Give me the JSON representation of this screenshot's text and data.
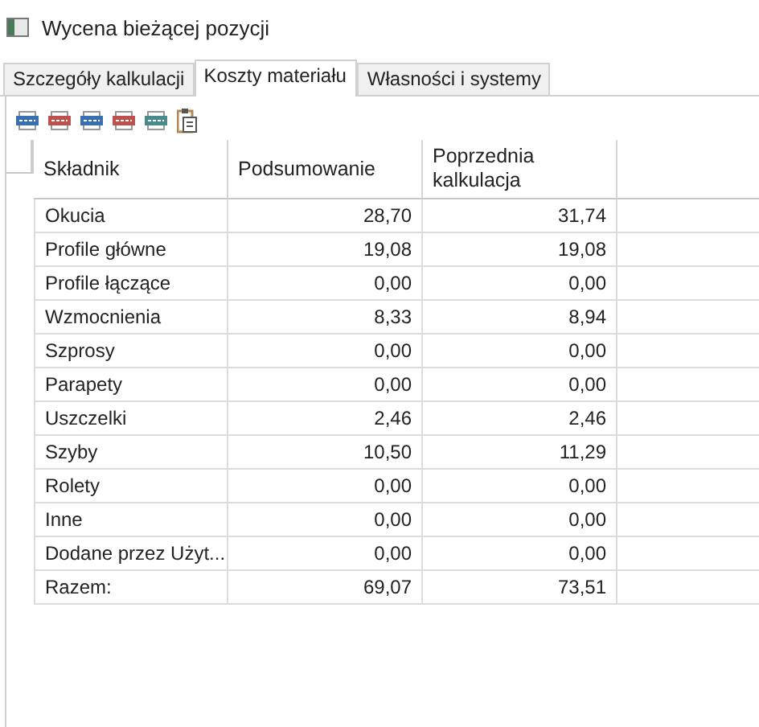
{
  "window": {
    "title": "Wycena bieżącej pozycji"
  },
  "tabs": [
    {
      "label": "Szczegóły kalkulacji",
      "selected": false
    },
    {
      "label": "Koszty materiału",
      "selected": true
    },
    {
      "label": "Własności i systemy",
      "selected": false
    }
  ],
  "toolbar": [
    {
      "kind": "csv",
      "color": "#3a6fb0"
    },
    {
      "kind": "pdf",
      "color": "#c0504d"
    },
    {
      "kind": "doc",
      "color": "#3a6fb0"
    },
    {
      "kind": "img",
      "color": "#c0504d"
    },
    {
      "kind": "xlsx",
      "color": "#4a8a8a"
    },
    {
      "kind": "clipboard",
      "color": "#b08a50"
    }
  ],
  "table": {
    "columns": [
      "Składnik",
      "Podsumowanie",
      "Poprzednia kalkulacja"
    ],
    "rows": [
      [
        "Okucia",
        "28,70",
        "31,74"
      ],
      [
        "Profile główne",
        "19,08",
        "19,08"
      ],
      [
        "Profile łączące",
        "0,00",
        "0,00"
      ],
      [
        "Wzmocnienia",
        "8,33",
        "8,94"
      ],
      [
        "Szprosy",
        "0,00",
        "0,00"
      ],
      [
        "Parapety",
        "0,00",
        "0,00"
      ],
      [
        "Uszczelki",
        "2,46",
        "2,46"
      ],
      [
        "Szyby",
        "10,50",
        "11,29"
      ],
      [
        "Rolety",
        "0,00",
        "0,00"
      ],
      [
        "Inne",
        "0,00",
        "0,00"
      ],
      [
        "Dodane przez Użyt...",
        "0,00",
        "0,00"
      ],
      [
        "Razem:",
        "69,07",
        "73,51"
      ]
    ]
  }
}
